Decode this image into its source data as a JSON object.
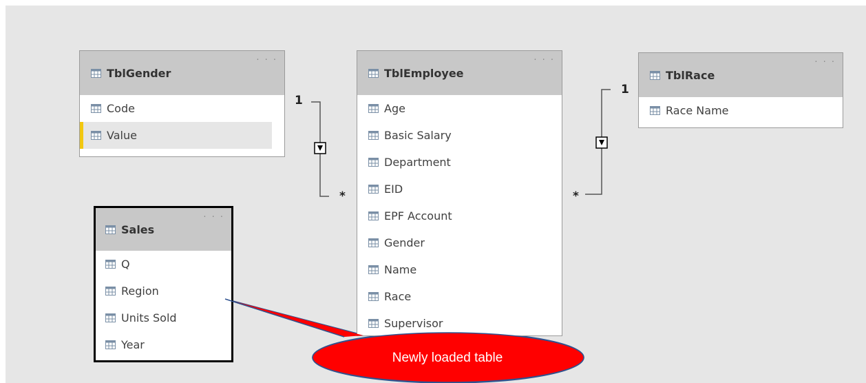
{
  "tables": [
    {
      "key": "gender",
      "title": "TblGender",
      "fields": [
        "Code",
        "Value"
      ],
      "selected_field": "Value"
    },
    {
      "key": "employee",
      "title": "TblEmployee",
      "fields": [
        "Age",
        "Basic Salary",
        "Department",
        "EID",
        "EPF Account",
        "Gender",
        "Name",
        "Race",
        "Supervisor"
      ]
    },
    {
      "key": "race",
      "title": "TblRace",
      "fields": [
        "Race Name"
      ]
    },
    {
      "key": "sales",
      "title": "Sales",
      "fields": [
        "Q",
        "Region",
        "Units Sold",
        "Year"
      ],
      "selected": true
    }
  ],
  "more_options_label": "· · ·",
  "relationships": [
    {
      "from": "TblGender",
      "to": "TblEmployee",
      "one_label": "1",
      "many_label": "*"
    },
    {
      "from": "TblRace",
      "to": "TblEmployee",
      "one_label": "1",
      "many_label": "*"
    }
  ],
  "callout": {
    "text": "Newly loaded table",
    "color": "#ff0000"
  },
  "colors": {
    "canvas": "#e6e6e6",
    "header": "#c8c8c8",
    "selected_row_accent": "#f2c811",
    "icon": "#7a8fa6"
  }
}
